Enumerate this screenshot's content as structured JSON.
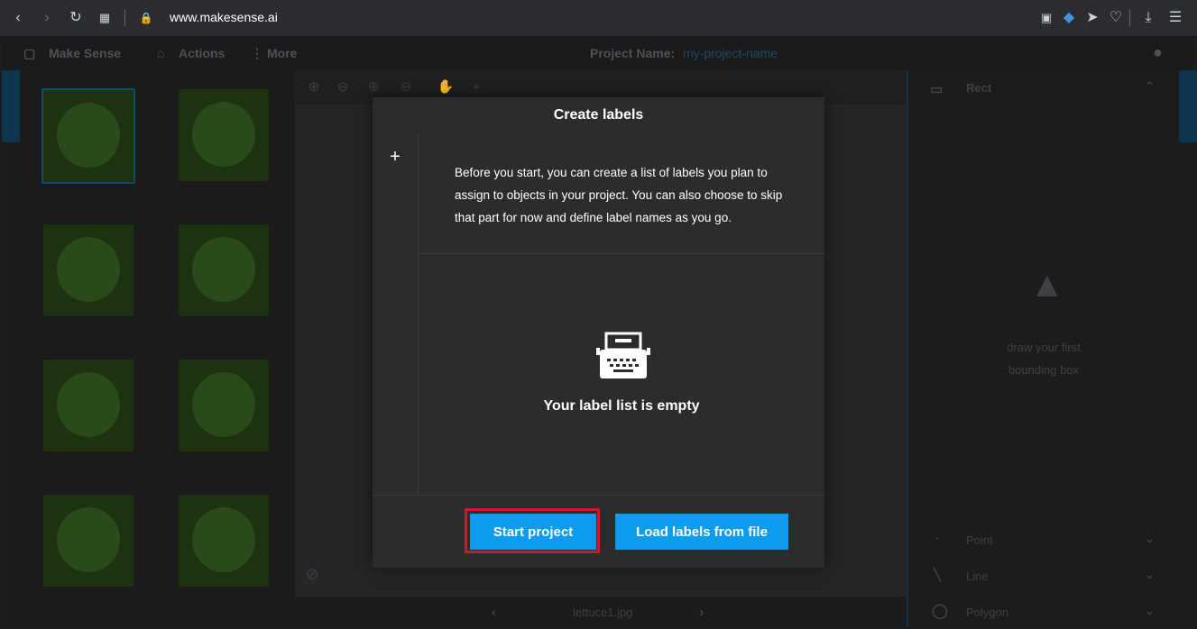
{
  "browser": {
    "url_host": "www.makesense.ai"
  },
  "nav": {
    "brand": "Make Sense",
    "actions": "Actions",
    "more": "More",
    "project_label": "Project Name:",
    "project_value": "my-project-name"
  },
  "editor": {
    "image_name": "lettuce1.jpg"
  },
  "right_panel": {
    "rect": "Rect",
    "placeholder_line1": "draw your first",
    "placeholder_line2": "bounding box",
    "point": "Point",
    "line": "Line",
    "polygon": "Polygon"
  },
  "modal": {
    "title": "Create labels",
    "add_icon": "+",
    "info_text": "Before you start, you can create a list of labels you plan to assign to objects in your project. You can also choose to skip that part for now and define label names as you go.",
    "empty_text": "Your label list is empty",
    "start_button": "Start project",
    "load_button": "Load labels from file"
  },
  "colors": {
    "accent": "#0b9bef",
    "highlight_outline": "#d3162b"
  }
}
